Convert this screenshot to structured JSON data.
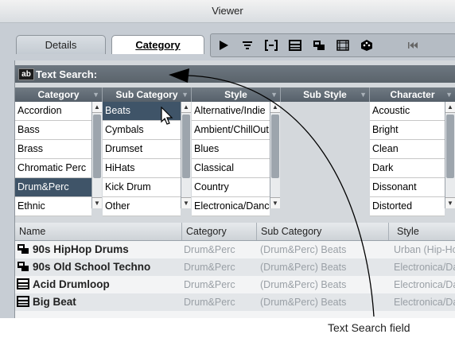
{
  "window": {
    "title": "Viewer"
  },
  "tabs": [
    {
      "label": "Details"
    },
    {
      "label": "Category"
    }
  ],
  "toolbar": {
    "icons": [
      "play-icon",
      "filter-list-icon",
      "bracket-icon",
      "list-view-icon",
      "device-icon",
      "grid-icon",
      "dice-icon",
      "rewind-icon"
    ]
  },
  "search": {
    "icon_label": "ab",
    "placeholder": "Text Search:"
  },
  "columns": {
    "category": {
      "header": "Category",
      "items": [
        "Accordion",
        "Bass",
        "Brass",
        "Chromatic Perc",
        "Drum&Perc",
        "Ethnic"
      ],
      "selected": 4
    },
    "sub_category": {
      "header": "Sub Category",
      "items": [
        "Beats",
        "Cymbals",
        "Drumset",
        "HiHats",
        "Kick Drum",
        "Other"
      ],
      "selected": 0
    },
    "style": {
      "header": "Style",
      "items": [
        "Alternative/Indie",
        "Ambient/ChillOut",
        "Blues",
        "Classical",
        "Country",
        "Electronica/Dance"
      ]
    },
    "sub_style": {
      "header": "Sub Style",
      "items": []
    },
    "character": {
      "header": "Character",
      "items": [
        "Acoustic",
        "Bright",
        "Clean",
        "Dark",
        "Dissonant",
        "Distorted"
      ]
    }
  },
  "results": {
    "headers": {
      "name": "Name",
      "category": "Category",
      "sub_category": "Sub Category",
      "style": "Style"
    },
    "rows": [
      {
        "icon": "device-icon",
        "name": "90s HipHop Drums",
        "category": "Drum&Perc",
        "sub_category": "(Drum&Perc) Beats",
        "style": "Urban (Hip-Hop)"
      },
      {
        "icon": "device-icon",
        "name": "90s Old School Techno",
        "category": "Drum&Perc",
        "sub_category": "(Drum&Perc) Beats",
        "style": "Electronica/Dance"
      },
      {
        "icon": "list-view-icon",
        "name": "Acid Drumloop",
        "category": "Drum&Perc",
        "sub_category": "(Drum&Perc) Beats",
        "style": "Electronica/Dance"
      },
      {
        "icon": "list-view-icon",
        "name": "Big Beat",
        "category": "Drum&Perc",
        "sub_category": "(Drum&Perc) Beats",
        "style": "Electronica/Dance"
      }
    ]
  },
  "caption": "Text Search field"
}
